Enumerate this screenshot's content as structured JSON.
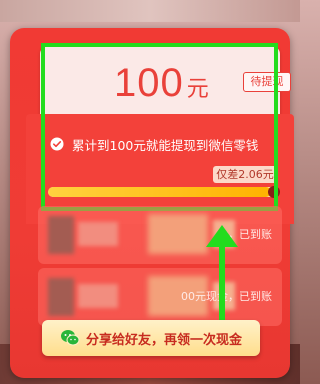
{
  "envelope": {
    "amount": "100",
    "currency_unit": "元",
    "pending_label": "待提现",
    "hint": "累计到100元就能提现到微信零钱",
    "remaining_label": "仅差2.06元",
    "progress_fraction": 0.98
  },
  "records": [
    {
      "status": "金，已到账"
    },
    {
      "status": "00元现金，已到账"
    }
  ],
  "share": {
    "label": "分享给好友，再领一次现金",
    "icon": "wechat-icon"
  },
  "colors": {
    "envelope_red": "#ef3c35",
    "highlight_green": "#23dc1e",
    "progress_yellow": "#ffc21a",
    "button_gold": "#ffde8c"
  }
}
